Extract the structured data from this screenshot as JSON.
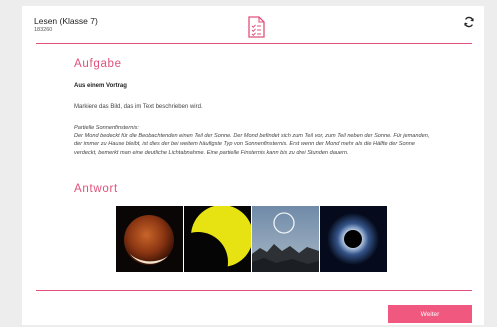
{
  "header": {
    "title": "Lesen (Klasse 7)",
    "subtitle": "183260",
    "center_icon": "document-checklist-icon",
    "right_icon": "refresh-icon"
  },
  "task": {
    "heading": "Aufgabe",
    "source": "Aus einem Vortrag",
    "instruction": "Markiere das Bild, das im Text beschrieben wird.",
    "text_title": "Partielle Sonnenfinsternis:",
    "text_body": "Der Mond bedeckt für die Beobachtenden einen Teil der Sonne. Der Mond befindet sich zum Teil vor, zum Teil neben der Sonne. Für jemanden, der immer zu Hause bleibt, ist dies der bei weitem häufigste Typ von Sonnenfinsternis. Erst wenn der Mond mehr als die Hälfte der Sonne verdeckt, bemerkt man eine deutliche Lichtabnahme. Eine partielle Finsternis kann bis zu drei Stunden dauern."
  },
  "answer": {
    "heading": "Antwort",
    "options": [
      {
        "icon": "lunar-eclipse-image"
      },
      {
        "icon": "partial-solar-eclipse-image"
      },
      {
        "icon": "ring-in-sky-landscape-image"
      },
      {
        "icon": "total-solar-eclipse-corona-image"
      }
    ]
  },
  "footer": {
    "next_label": "Weiter"
  },
  "colors": {
    "accent": "#e2507a",
    "button": "#f0587f",
    "background": "#ededed"
  }
}
